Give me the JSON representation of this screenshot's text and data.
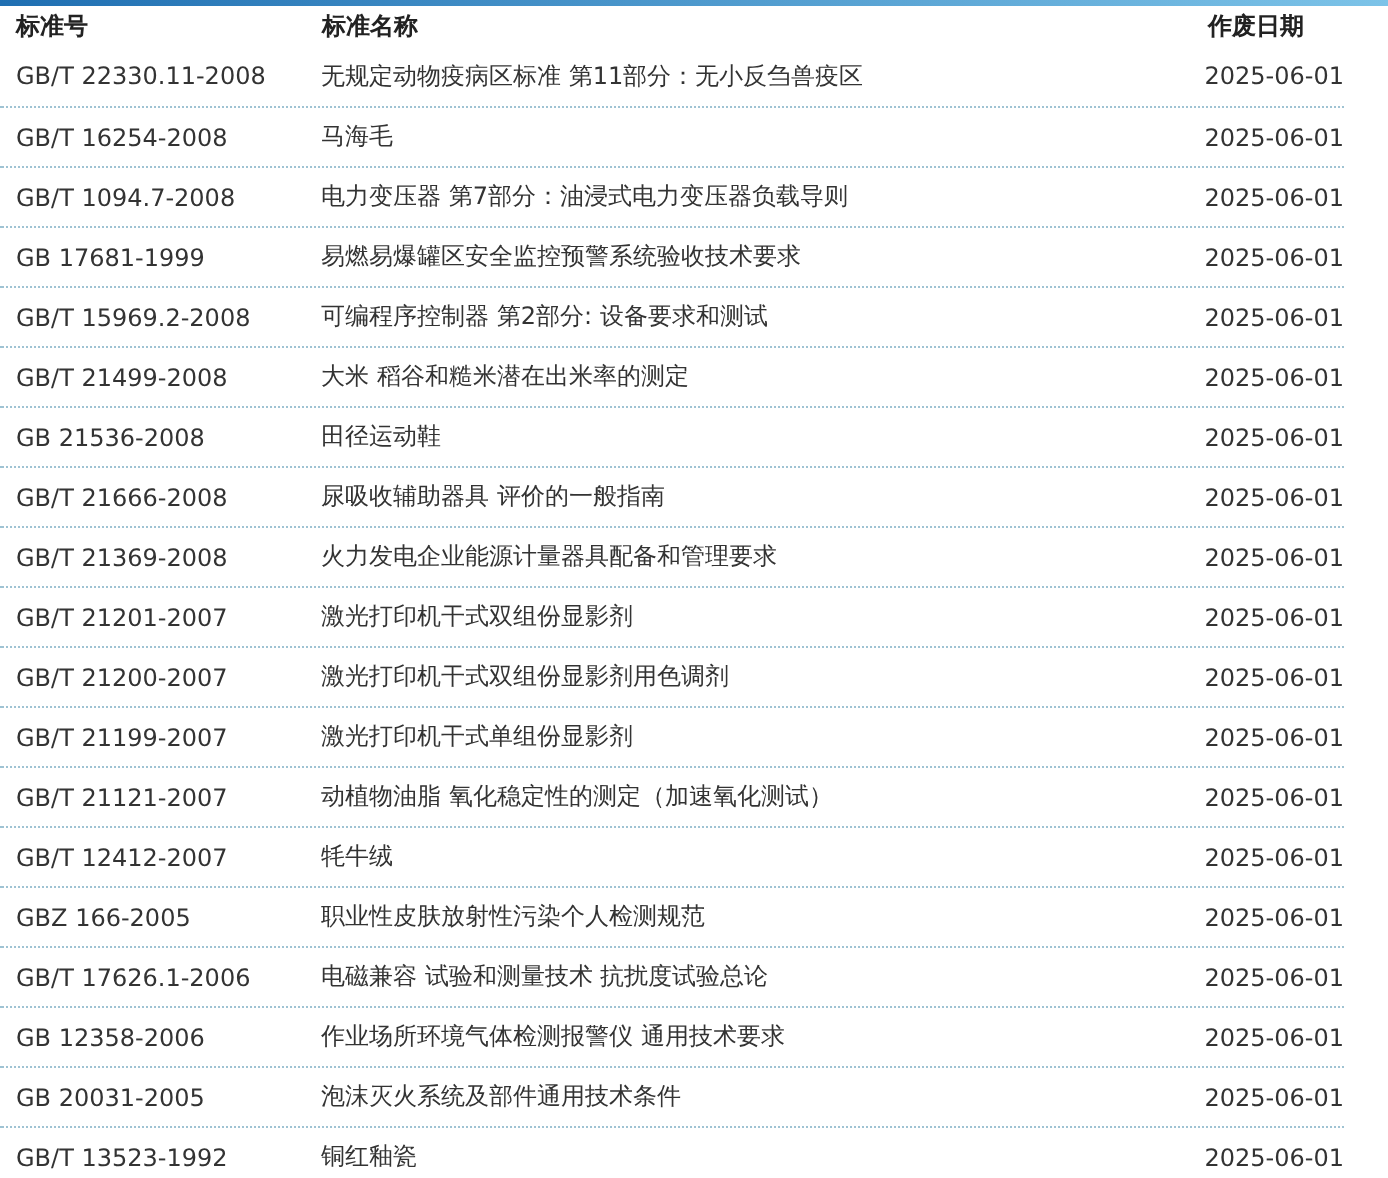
{
  "table": {
    "columns": [
      "标准号",
      "标准名称",
      "作废日期"
    ],
    "rows": [
      {
        "code": "GB/T 22330.11-2008",
        "name": "无规定动物疫病区标准 第11部分：无小反刍兽疫区",
        "date": "2025-06-01"
      },
      {
        "code": "GB/T 16254-2008",
        "name": "马海毛",
        "date": "2025-06-01"
      },
      {
        "code": "GB/T 1094.7-2008",
        "name": "电力变压器 第7部分：油浸式电力变压器负载导则",
        "date": "2025-06-01"
      },
      {
        "code": "GB 17681-1999",
        "name": "易燃易爆罐区安全监控预警系统验收技术要求",
        "date": "2025-06-01"
      },
      {
        "code": "GB/T 15969.2-2008",
        "name": "可编程序控制器 第2部分: 设备要求和测试",
        "date": "2025-06-01"
      },
      {
        "code": "GB/T 21499-2008",
        "name": "大米 稻谷和糙米潜在出米率的测定",
        "date": "2025-06-01"
      },
      {
        "code": "GB 21536-2008",
        "name": "田径运动鞋",
        "date": "2025-06-01"
      },
      {
        "code": "GB/T 21666-2008",
        "name": "尿吸收辅助器具 评价的一般指南",
        "date": "2025-06-01"
      },
      {
        "code": "GB/T 21369-2008",
        "name": "火力发电企业能源计量器具配备和管理要求",
        "date": "2025-06-01"
      },
      {
        "code": "GB/T 21201-2007",
        "name": "激光打印机干式双组份显影剂",
        "date": "2025-06-01"
      },
      {
        "code": "GB/T 21200-2007",
        "name": "激光打印机干式双组份显影剂用色调剂",
        "date": "2025-06-01"
      },
      {
        "code": "GB/T 21199-2007",
        "name": "激光打印机干式单组份显影剂",
        "date": "2025-06-01"
      },
      {
        "code": "GB/T 21121-2007",
        "name": "动植物油脂 氧化稳定性的测定（加速氧化测试）",
        "date": "2025-06-01"
      },
      {
        "code": "GB/T 12412-2007",
        "name": "牦牛绒",
        "date": "2025-06-01"
      },
      {
        "code": "GBZ 166-2005",
        "name": "职业性皮肤放射性污染个人检测规范",
        "date": "2025-06-01"
      },
      {
        "code": "GB/T 17626.1-2006",
        "name": "电磁兼容 试验和测量技术 抗扰度试验总论",
        "date": "2025-06-01"
      },
      {
        "code": "GB 12358-2006",
        "name": "作业场所环境气体检测报警仪 通用技术要求",
        "date": "2025-06-01"
      },
      {
        "code": "GB 20031-2005",
        "name": "泡沫灭火系统及部件通用技术条件",
        "date": "2025-06-01"
      },
      {
        "code": "GB/T 13523-1992",
        "name": "铜红釉瓷",
        "date": "2025-06-01"
      }
    ]
  }
}
